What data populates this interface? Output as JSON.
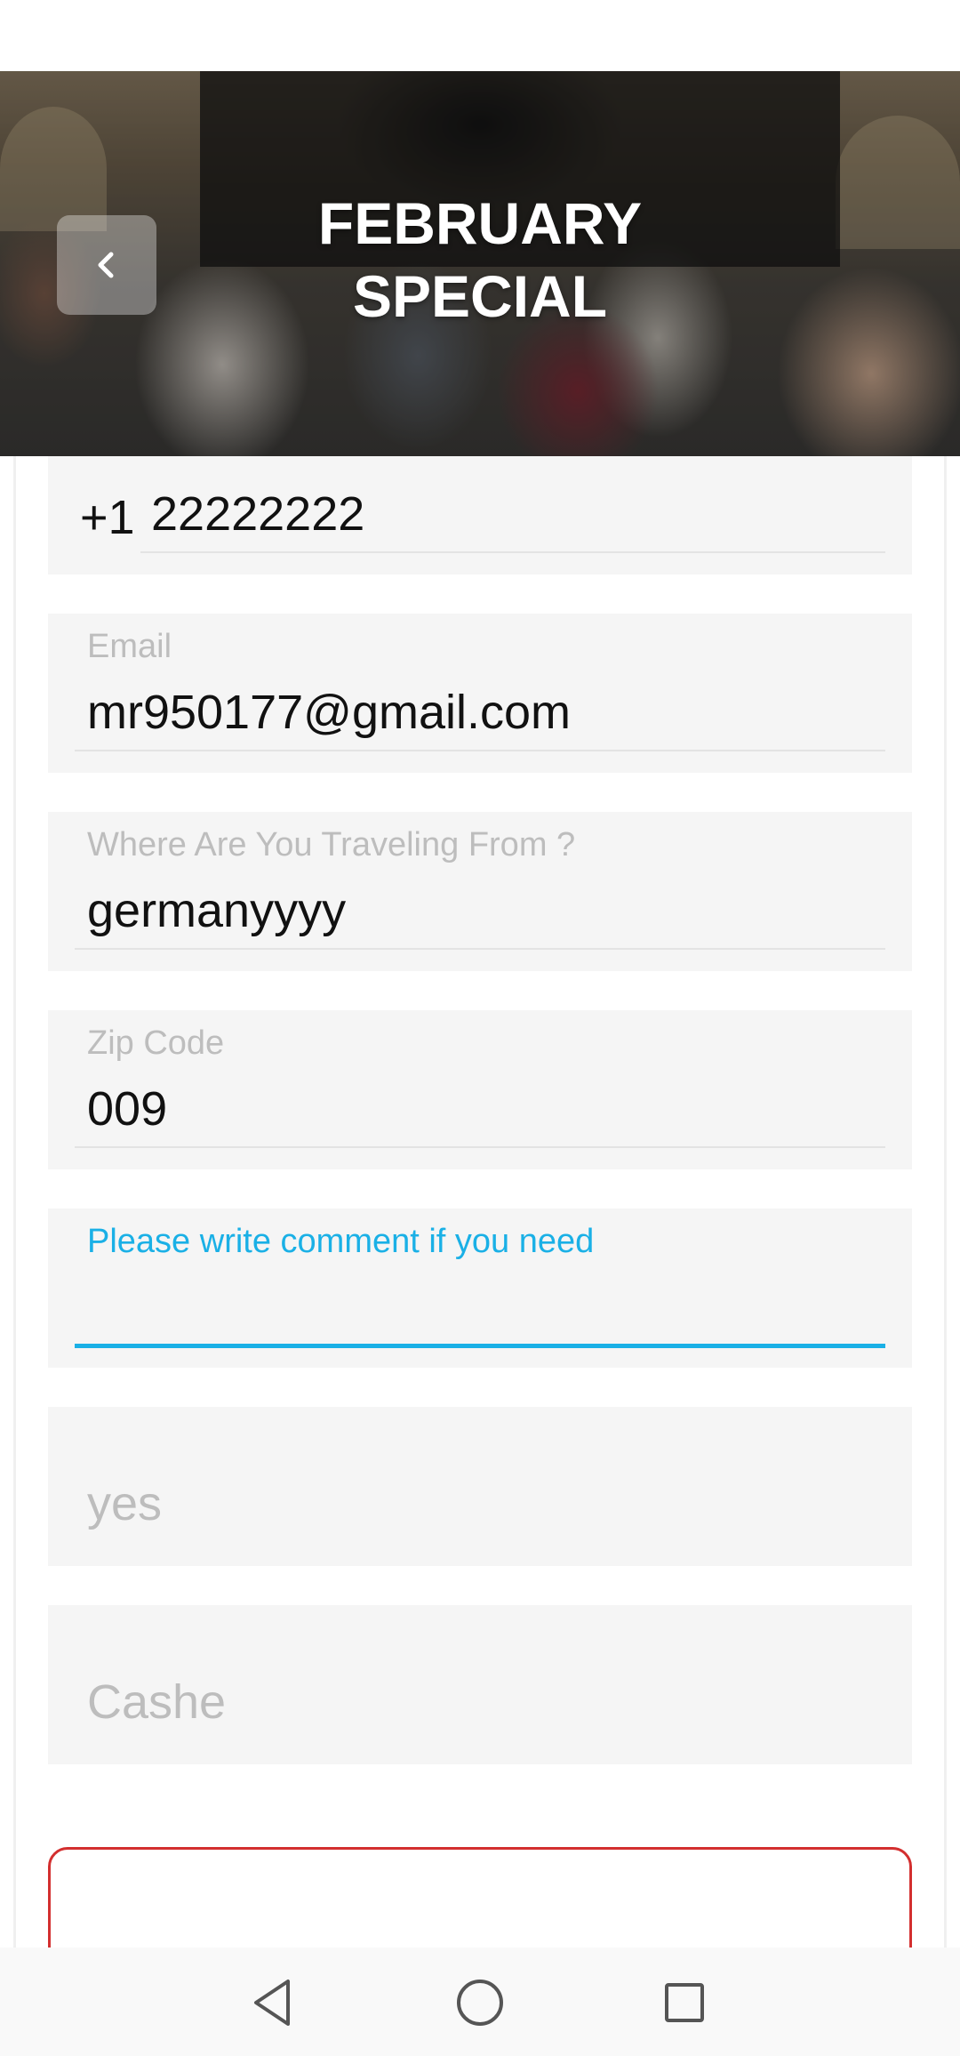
{
  "header": {
    "title": "FEBRUARY SPECIAL",
    "back_icon": "chevron-left-icon"
  },
  "form": {
    "phone": {
      "prefix": "+1",
      "value": "22222222"
    },
    "email": {
      "label": "Email",
      "value": "mr950177@gmail.com"
    },
    "traveling_from": {
      "label": "Where Are You Traveling From ?",
      "value": "germanyyyy"
    },
    "zip_code": {
      "label": "Zip Code",
      "value": "009"
    },
    "comment": {
      "label": "Please write comment if you need",
      "value": ""
    },
    "option_one": {
      "placeholder": "yes"
    },
    "option_two": {
      "placeholder": "Cashe"
    }
  },
  "colors": {
    "accent": "#1ab0e6",
    "submit_border": "#d32f2f",
    "field_background": "#f5f5f5"
  },
  "nav": {
    "back_icon": "triangle-back-icon",
    "home_icon": "circle-home-icon",
    "recents_icon": "square-recents-icon"
  }
}
